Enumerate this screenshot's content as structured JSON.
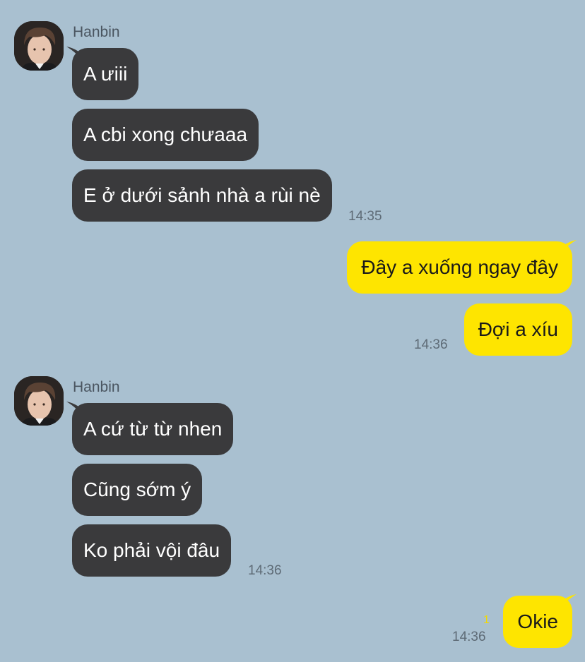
{
  "colors": {
    "background": "#A9C0D0",
    "incoming_bubble": "#3A3A3C",
    "outgoing_bubble": "#FEE500",
    "timestamp": "#5E6B76",
    "unread_count": "#F2D900"
  },
  "groups": [
    {
      "sender": "Hanbin",
      "messages": [
        "A ưiii",
        "A cbi xong chưaaa",
        "E ở dưới sảnh nhà a rùi nè"
      ],
      "time": "14:35"
    },
    {
      "sender": "me",
      "messages": [
        "Đây a xuống ngay đây",
        "Đợi a xíu"
      ],
      "time": "14:36"
    },
    {
      "sender": "Hanbin",
      "messages": [
        "A cứ từ từ nhen",
        "Cũng sớm ý",
        "Ko phải vội đâu"
      ],
      "time": "14:36"
    },
    {
      "sender": "me",
      "messages": [
        "Okie"
      ],
      "time": "14:36",
      "unread": "1"
    }
  ]
}
